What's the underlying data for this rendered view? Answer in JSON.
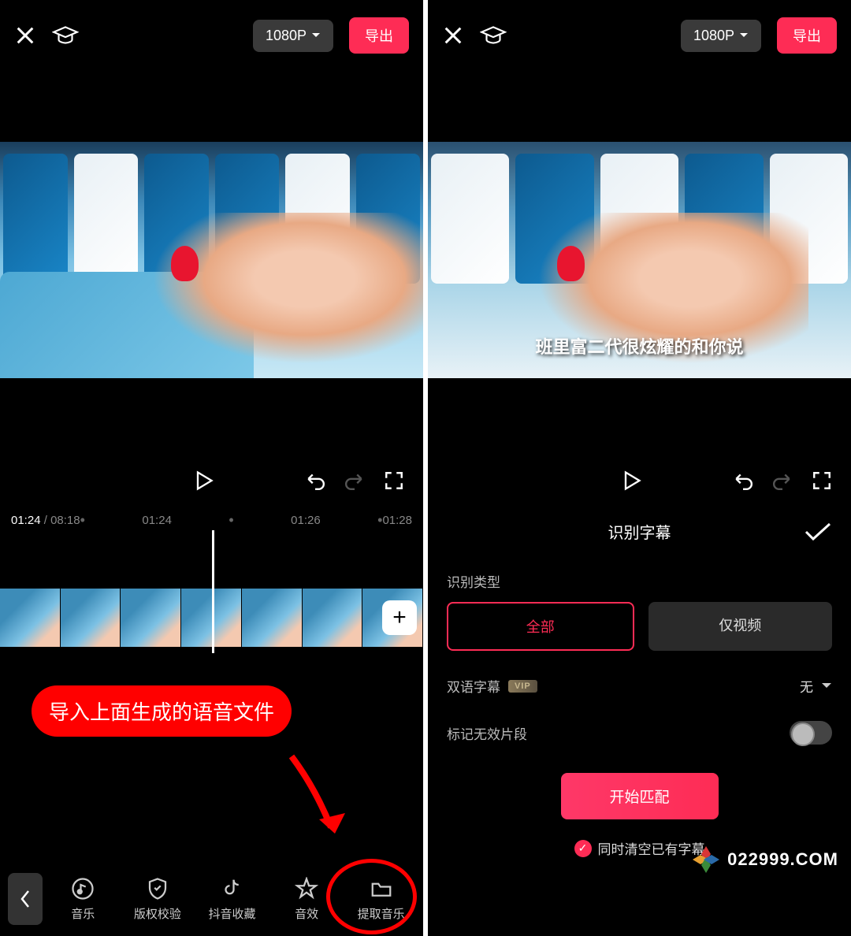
{
  "left": {
    "header": {
      "resolution": "1080P",
      "export": "导出"
    },
    "timeline": {
      "current": "01:24",
      "total": "08:18",
      "marks": [
        "01:24",
        "01:26",
        "01:28"
      ]
    },
    "bottom_bar": {
      "items": [
        {
          "label": "音乐"
        },
        {
          "label": "版权校验"
        },
        {
          "label": "抖音收藏"
        },
        {
          "label": "音效"
        },
        {
          "label": "提取音乐"
        }
      ]
    },
    "annotation": "导入上面生成的语音文件"
  },
  "right": {
    "header": {
      "resolution": "1080P",
      "export": "导出"
    },
    "subtitle_overlay": "班里富二代很炫耀的和你说",
    "panel": {
      "title": "识别字幕",
      "type_label": "识别类型",
      "type_all": "全部",
      "type_video": "仅视频",
      "bilingual_label": "双语字幕",
      "bilingual_badge": "VIP",
      "bilingual_value": "无",
      "mark_invalid_label": "标记无效片段",
      "start_match": "开始匹配",
      "clear_existing": "同时清空已有字幕"
    }
  },
  "watermark": "022999.COM"
}
